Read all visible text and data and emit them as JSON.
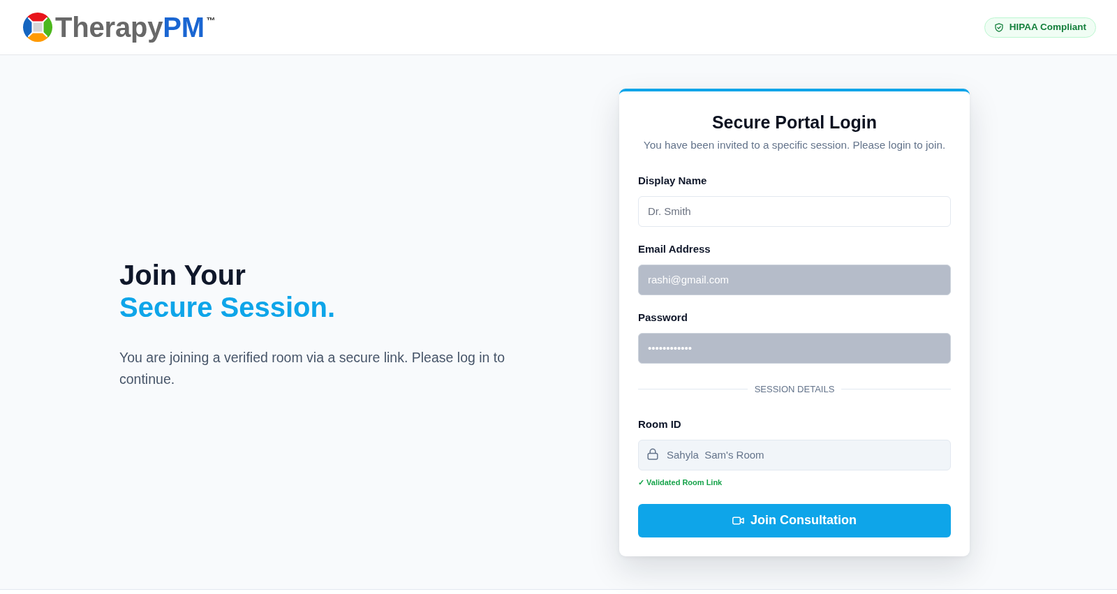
{
  "header": {
    "logo": {
      "text": "Therapy",
      "accent": "PM",
      "trademark": "™"
    },
    "badge": "HIPAA Compliant"
  },
  "hero": {
    "title": "Join Your",
    "title_accent": "Secure Session.",
    "text": "You are joining a verified room via a secure link. Please log in to continue."
  },
  "login_card": {
    "title": "Secure Portal Login",
    "subtitle": "You have been invited to a specific session. Please login to join.",
    "fields": [
      {
        "label": "Display Name",
        "placeholder": "Dr. Smith",
        "autofilled": false
      },
      {
        "label": "Email Address",
        "value": "rashi@gmail.com",
        "autofilled": true
      },
      {
        "label": "Password",
        "value": "••••••••••••",
        "autofilled": true
      }
    ],
    "section_divider": "SESSION DETAILS",
    "room": {
      "label": "Room ID",
      "value": "Sahyla  Sam's Room",
      "locked": true,
      "note": "✓ Validated Room Link"
    },
    "button": "Join Consultation"
  }
}
